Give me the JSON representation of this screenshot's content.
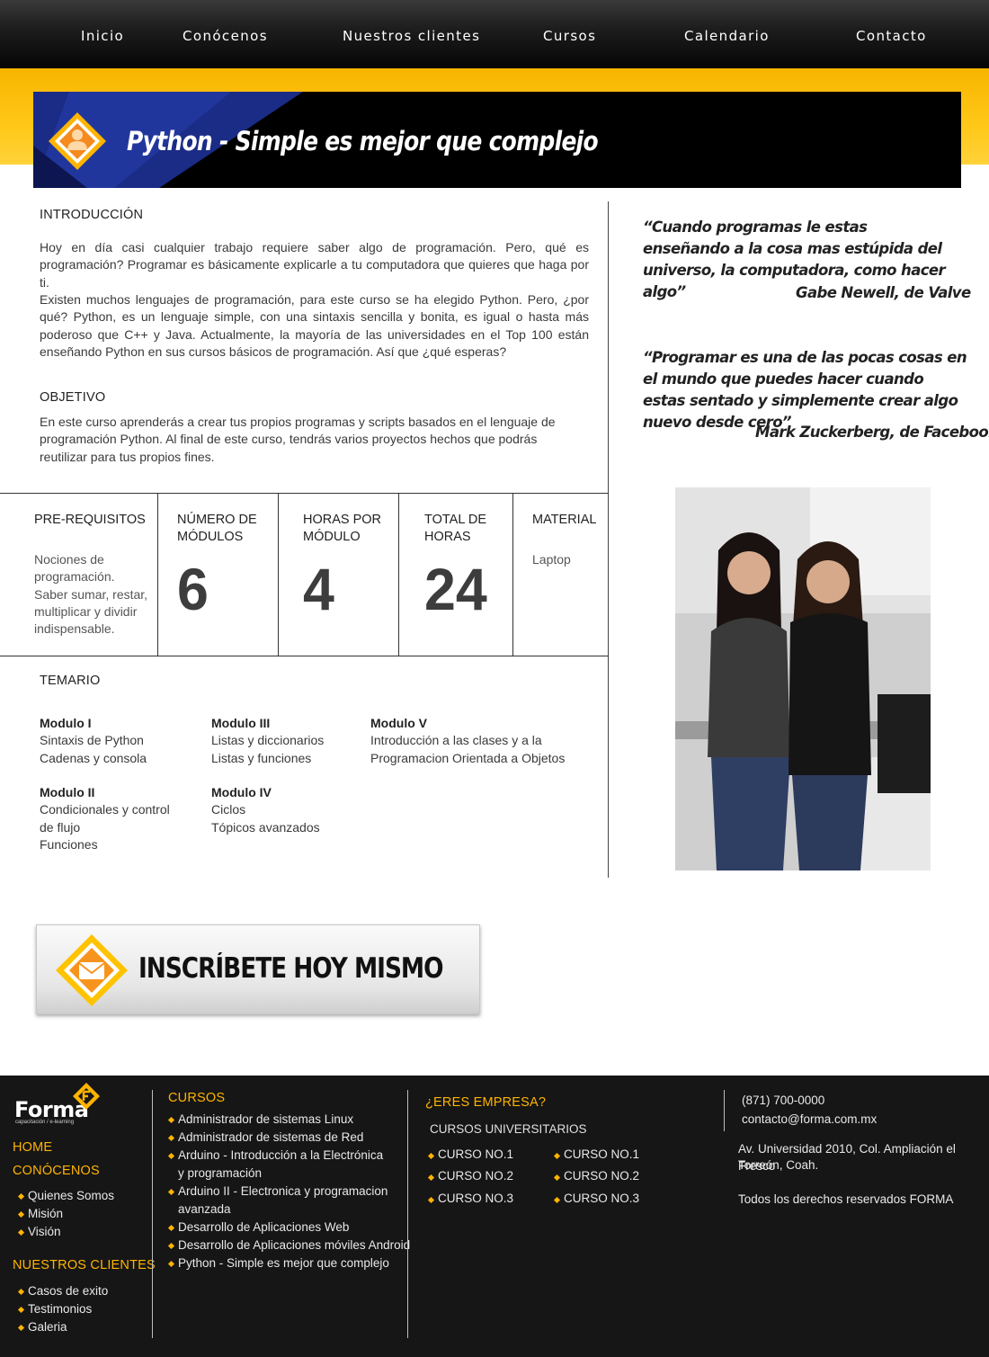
{
  "nav": {
    "items": [
      "Inicio",
      "Conócenos",
      "Nuestros clientes",
      "Cursos",
      "Calendario",
      "Contacto"
    ]
  },
  "hero": {
    "title": "Python - Simple es mejor que complejo",
    "icon": "person-icon",
    "colors": {
      "band": "#ffc818",
      "dark": "#000000",
      "accent": "#1a2a7a"
    }
  },
  "intro": {
    "heading": "INTRODUCCIÓN",
    "p1": "Hoy en día casi cualquier trabajo requiere saber algo de programación. Pero, qué es programación? Programar es básicamente explicarle a tu computadora que quieres que haga por ti.",
    "p2": "Existen muchos lenguajes de programación, para este curso se ha elegido Python. Pero, ¿por qué? Python, es un lenguaje simple, con una sintaxis sencilla y bonita, es igual o hasta más poderoso que C++ y Java. Actualmente, la mayoría de las universidades en el Top 100 están enseñando Python en sus cursos básicos de programación. Así que ¿qué esperas?"
  },
  "objetivo": {
    "heading": "OBJETIVO",
    "text": "En este curso aprenderás a crear tus propios programas y scripts basados en el lenguaje de programación Python. Al final de este curso, tendrás varios proyectos hechos que podrás reutilizar para tus propios fines."
  },
  "info": {
    "prereq_label": "PRE-REQUISITOS",
    "prereq_text": "Nociones de programación. Saber sumar, restar, multiplicar y dividir indispensable.",
    "modules_label": "NÚMERO DE MÓDULOS",
    "modules_value": "6",
    "hours_label": "HORAS POR MÓDULO",
    "hours_value": "4",
    "total_label": "TOTAL DE HORAS",
    "total_value": "24",
    "material_label": "MATERIAL",
    "material_value": "Laptop"
  },
  "temario": {
    "heading": "TEMARIO",
    "modules": [
      {
        "title": "Modulo I",
        "lines": [
          "Sintaxis de Python",
          "Cadenas y consola"
        ]
      },
      {
        "title": "Modulo II",
        "lines": [
          "Condicionales y control de flujo",
          "Funciones"
        ]
      },
      {
        "title": "Modulo III",
        "lines": [
          "Listas y diccionarios",
          "Listas y funciones"
        ]
      },
      {
        "title": "Modulo IV",
        "lines": [
          "Ciclos",
          "Tópicos avanzados"
        ]
      },
      {
        "title": "Modulo V",
        "lines": [
          "Introducción a las clases y a la Programacion Orientada a Objetos"
        ]
      }
    ]
  },
  "quotes": [
    {
      "text": "“Cuando programas le estas enseñando a la cosa mas estúpida del universo, la computadora, como hacer algo”",
      "author": "Gabe Newell, de Valve"
    },
    {
      "text": "“Programar es una de las pocas cosas en el mundo que puedes hacer cuando estas sentado y simplemente crear algo nuevo desde cero”",
      "author": "Mark Zuckerberg, de Facebook"
    }
  ],
  "cta": {
    "label": "INSCRÍBETE HOY MISMO",
    "icon": "envelope-icon"
  },
  "footer": {
    "logo": "Forma",
    "logo_sub": "capacitación / e-learning",
    "home": "HOME",
    "conocenos": "CONÓCENOS",
    "conocenos_items": [
      "Quienes Somos",
      "Misión",
      "Visión"
    ],
    "clientes": "NUESTROS CLIENTES",
    "clientes_items": [
      "Casos de exito",
      "Testimonios",
      "Galeria"
    ],
    "cursos_heading": "CURSOS",
    "cursos_items": [
      "Administrador de sistemas Linux",
      "Administrador de sistemas de Red",
      "Arduino - Introducción a la Electrónica",
      "y programación",
      "Arduino II - Electronica y programacion",
      "avanzada",
      "Desarrollo de Aplicaciones Web",
      "Desarrollo de Aplicaciones móviles Android",
      "Python - Simple es mejor que complejo"
    ],
    "empresa_heading": "¿ERES EMPRESA?",
    "universitarios": "CURSOS UNIVERSITARIOS",
    "cursos_col1": [
      "CURSO NO.1",
      "CURSO NO.2",
      "CURSO NO.3"
    ],
    "cursos_col2": [
      "CURSO NO.1",
      "CURSO NO.2",
      "CURSO NO.3"
    ],
    "phone": "(871) 700-0000",
    "email": "contacto@forma.com.mx",
    "address1": "Av. Universidad 2010, Col. Ampliación el Fresco",
    "address2": "Torreón, Coah.",
    "rights": "Todos los derechos reservados FORMA"
  }
}
